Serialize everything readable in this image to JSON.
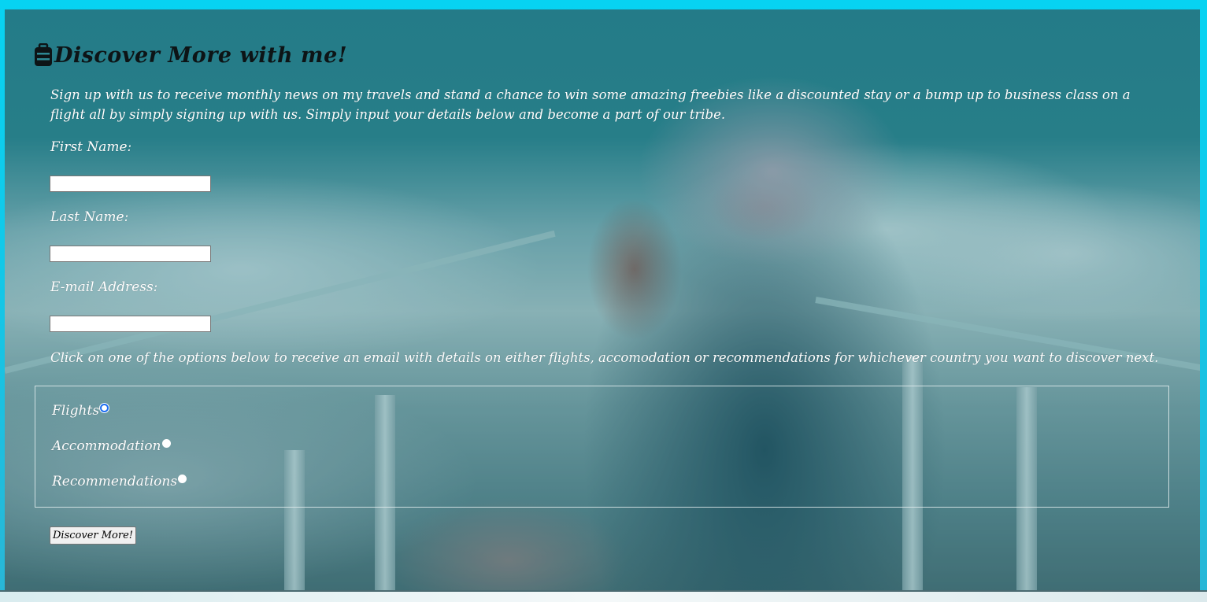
{
  "colors": {
    "frame": "#0ad7f4",
    "title": "#0d1416",
    "text": "#ffffff",
    "radio_checked_accent": "#1a6cf0"
  },
  "title": {
    "icon": "suitcase-icon",
    "text": "Discover More with me!"
  },
  "intro": "Sign up with us to receive monthly news on my travels and stand a chance to win some amazing freebies like a discounted stay or a bump up to business class on a flight all by simply signing up with us. Simply input your details below and become a part of our tribe.",
  "form": {
    "first_name": {
      "label": "First Name:",
      "value": ""
    },
    "last_name": {
      "label": "Last Name:",
      "value": ""
    },
    "email": {
      "label": "E-mail Address:",
      "value": ""
    },
    "instructions": "Click on one of the options below to receive an email with details on either flights, accomodation or recommendations for whichever country you want to discover next.",
    "options": [
      {
        "label": "Flights",
        "selected": true
      },
      {
        "label": "Accommodation",
        "selected": false
      },
      {
        "label": "Recommendations",
        "selected": false
      }
    ],
    "submit_label": "Discover More!"
  }
}
